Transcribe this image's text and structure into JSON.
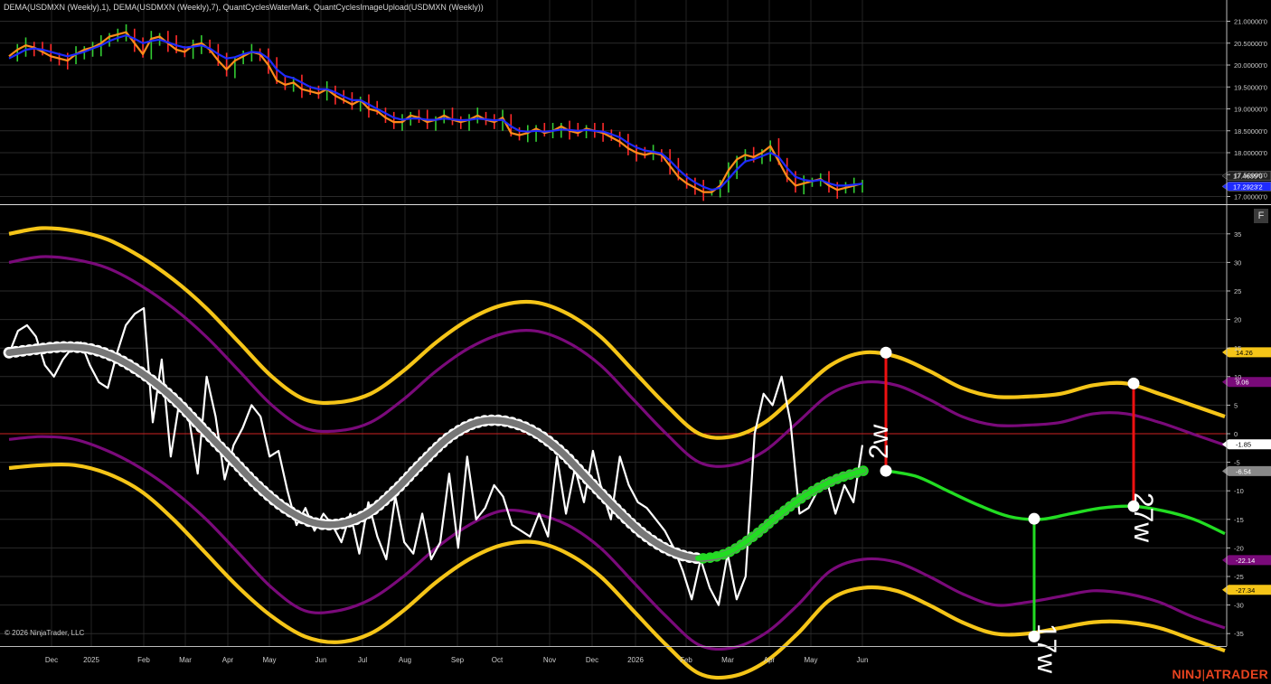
{
  "header": {
    "indicators": "DEMA(USDMXN (Weekly),1), DEMA(USDMXN (Weekly),7), QuantCyclesWaterMark, QuantCyclesImageUpload(USDMXN (Weekly))"
  },
  "footer": {
    "copyright": "© 2026 NinjaTrader, LLC",
    "brand": "NINJATRADER"
  },
  "toolbar": {
    "f_label": "F"
  },
  "colors": {
    "background": "#000000",
    "grid": "#2a2a2a",
    "axis_text": "#cccccc",
    "ma_fast": "#ff8c1a",
    "ma_slow": "#1f2bff",
    "candle_up": "#33cc33",
    "candle_down": "#ff2a2a",
    "outer_band": "#f5c518",
    "inner_band": "#7a0a7a",
    "cycle": "#777777",
    "cycle_dots": "#ffffff",
    "cycle_active": "#22dd22",
    "oscillator": "#ffffff",
    "zero_line": "#cc2222",
    "projection": "#22dd22",
    "marker_red": "#ee1111",
    "marker_green": "#22dd22",
    "brand": "#e8431f"
  },
  "chart_data": [
    {
      "type": "line",
      "name": "price-panel",
      "title": "USDMXN (Weekly)",
      "y_ticks": [
        "21.00000'0",
        "20.50000'0",
        "20.00000'0",
        "19.50000'0",
        "19.00000'0",
        "18.50000'0",
        "18.00000'0",
        "17.50000'0",
        "17.00000'0"
      ],
      "ylim": [
        16.97,
        21.25
      ],
      "series": [
        {
          "name": "DEMA(USDMXN (Weekly),1)",
          "color": "#ff8c1a",
          "values": [
            20.2,
            20.35,
            20.45,
            20.4,
            20.3,
            20.2,
            20.15,
            20.1,
            20.25,
            20.35,
            20.4,
            20.5,
            20.65,
            20.7,
            20.75,
            20.5,
            20.25,
            20.6,
            20.65,
            20.5,
            20.35,
            20.3,
            20.45,
            20.5,
            20.35,
            20.1,
            19.9,
            20.1,
            20.2,
            20.3,
            20.25,
            20.0,
            19.65,
            19.55,
            19.6,
            19.45,
            19.4,
            19.35,
            19.45,
            19.3,
            19.2,
            19.1,
            19.2,
            19.0,
            18.95,
            18.8,
            18.7,
            18.7,
            18.85,
            18.8,
            18.7,
            18.75,
            18.85,
            18.75,
            18.7,
            18.75,
            18.85,
            18.75,
            18.7,
            18.8,
            18.45,
            18.4,
            18.45,
            18.55,
            18.45,
            18.5,
            18.6,
            18.5,
            18.45,
            18.55,
            18.5,
            18.45,
            18.35,
            18.25,
            18.1,
            18.0,
            17.95,
            18.0,
            17.95,
            17.7,
            17.45,
            17.3,
            17.2,
            17.1,
            17.1,
            17.25,
            17.6,
            17.85,
            17.95,
            17.9,
            18.0,
            18.15,
            17.8,
            17.45,
            17.25,
            17.3,
            17.35,
            17.4,
            17.25,
            17.15,
            17.2,
            17.25,
            17.3
          ]
        },
        {
          "name": "DEMA(USDMXN (Weekly),7)",
          "color": "#1f2bff",
          "values": [
            20.15,
            20.25,
            20.35,
            20.38,
            20.35,
            20.3,
            20.25,
            20.2,
            20.25,
            20.3,
            20.38,
            20.45,
            20.55,
            20.62,
            20.68,
            20.6,
            20.5,
            20.55,
            20.58,
            20.52,
            20.45,
            20.4,
            20.42,
            20.45,
            20.38,
            20.25,
            20.15,
            20.18,
            20.25,
            20.3,
            20.28,
            20.15,
            19.9,
            19.75,
            19.7,
            19.6,
            19.5,
            19.45,
            19.45,
            19.38,
            19.28,
            19.2,
            19.2,
            19.1,
            19.0,
            18.9,
            18.8,
            18.75,
            18.78,
            18.78,
            18.75,
            18.75,
            18.78,
            18.76,
            18.74,
            18.75,
            18.78,
            18.76,
            18.74,
            18.75,
            18.6,
            18.5,
            18.48,
            18.5,
            18.48,
            18.5,
            18.53,
            18.52,
            18.5,
            18.52,
            18.5,
            18.48,
            18.42,
            18.35,
            18.22,
            18.12,
            18.05,
            18.02,
            17.98,
            17.82,
            17.62,
            17.45,
            17.32,
            17.22,
            17.15,
            17.2,
            17.4,
            17.62,
            17.8,
            17.85,
            17.92,
            18.0,
            17.9,
            17.65,
            17.45,
            17.38,
            17.35,
            17.38,
            17.3,
            17.25,
            17.25,
            17.27,
            17.29
          ]
        }
      ],
      "price_labels": [
        "17.4639'0",
        "17.2923'2"
      ]
    },
    {
      "type": "line",
      "name": "cycle-panel",
      "y_ticks": [
        35,
        30,
        25,
        20,
        15,
        10,
        5,
        0,
        -5,
        -10,
        -15,
        -20,
        -25,
        -30,
        -35
      ],
      "ylim": [
        -36.7,
        39.3
      ],
      "x_ticks": [
        "Dec",
        "2025",
        "Feb",
        "Mar",
        "Apr",
        "May",
        "Jun",
        "Jul",
        "Aug",
        "Sep",
        "Oct",
        "Nov",
        "Dec",
        "2026",
        "Feb",
        "Mar",
        "Apr",
        "May",
        "Jun"
      ],
      "value_labels": [
        {
          "text": "14.26",
          "value": 14.26,
          "color": "#f5c518"
        },
        {
          "text": "9.06",
          "value": 9.06,
          "color": "#7a0a7a"
        },
        {
          "text": "-1.85",
          "value": -1.85,
          "color": "#ffffff"
        },
        {
          "text": "-6.54",
          "value": -6.54,
          "color": "#888888"
        },
        {
          "text": "-22.14",
          "value": -22.14,
          "color": "#7a0a7a"
        },
        {
          "text": "-27.34",
          "value": -27.34,
          "color": "#f5c518"
        }
      ],
      "annotations": [
        {
          "text": "2w",
          "color": "#ee1111",
          "y_top": 14.2,
          "y_bottom": -6.5
        },
        {
          "text": "27w",
          "color": "#ee1111",
          "y_top": 8.8,
          "y_bottom": -12.7
        },
        {
          "text": "17w",
          "color": "#22dd22",
          "y_top": -14.9,
          "y_bottom": -35.5
        }
      ],
      "series": [
        {
          "name": "outer-upper",
          "color": "#f5c518",
          "values": [
            35,
            36,
            35.5,
            34,
            31,
            27,
            22,
            16,
            10,
            6,
            5.5,
            7,
            11,
            16,
            20,
            22.5,
            23,
            21,
            17,
            11,
            5,
            0,
            -0.5,
            2,
            7,
            12,
            14.2,
            13.5,
            11,
            8,
            6.5,
            6.5,
            7,
            8.5,
            8.8,
            7,
            5,
            3
          ]
        },
        {
          "name": "inner-upper",
          "color": "#7a0a7a",
          "values": [
            30,
            31,
            30.5,
            29,
            26,
            22,
            17,
            11,
            5,
            1,
            0.5,
            2,
            6,
            11,
            15,
            17.5,
            18,
            16,
            12,
            6,
            0,
            -5,
            -5.5,
            -3,
            2,
            7,
            9,
            8.5,
            6,
            3,
            1.5,
            1.5,
            2,
            3.5,
            3.5,
            2,
            0,
            -2
          ]
        },
        {
          "name": "inner-lower",
          "color": "#7a0a7a",
          "values": [
            -1,
            -0.5,
            -1,
            -3,
            -6,
            -10,
            -15,
            -21,
            -27,
            -31,
            -31,
            -29,
            -25,
            -20,
            -16,
            -13.5,
            -14,
            -16,
            -20,
            -26,
            -32,
            -37,
            -37.5,
            -35,
            -30,
            -24,
            -22,
            -22.5,
            -25,
            -28,
            -30,
            -29.5,
            -28.5,
            -27.5,
            -28,
            -29.5,
            -32,
            -34
          ]
        },
        {
          "name": "outer-lower",
          "color": "#f5c518",
          "values": [
            -6,
            -5.5,
            -5.5,
            -7,
            -10,
            -15,
            -21,
            -27,
            -32,
            -35.5,
            -36.5,
            -35,
            -31,
            -26,
            -22,
            -19.5,
            -19,
            -21,
            -25,
            -31,
            -37,
            -42,
            -42.5,
            -40,
            -35,
            -29,
            -27,
            -27.5,
            -30,
            -33,
            -35,
            -35,
            -34,
            -33,
            -33,
            -34,
            -36,
            -38
          ]
        },
        {
          "name": "cycle",
          "color": "#777777",
          "values": [
            14.2,
            14.8,
            15.2,
            14.8,
            13,
            10,
            6,
            1,
            -4,
            -9,
            -13,
            -15.5,
            -15.8,
            -14,
            -10,
            -5,
            -0.5,
            2,
            2.2,
            0.5,
            -3,
            -8,
            -13,
            -17.5,
            -20.5,
            -21.8,
            -21,
            -18,
            -14,
            -10.5,
            -8,
            -6.5
          ]
        },
        {
          "name": "projection",
          "color": "#22dd22",
          "values": [
            -6.5,
            -7.5,
            -10,
            -12.5,
            -14.5,
            -15,
            -14,
            -13,
            -12.7,
            -13.5,
            -15,
            -17.5
          ]
        },
        {
          "name": "oscillator",
          "color": "#ffffff",
          "values": [
            14,
            18,
            19,
            17,
            12,
            10,
            13,
            15,
            16,
            12,
            9,
            8,
            14,
            19,
            21,
            22,
            2,
            13,
            -4,
            6,
            3,
            -7,
            10,
            3,
            -8,
            -2,
            1,
            5,
            3,
            -4,
            -3,
            -10,
            -16,
            -13,
            -17,
            -14,
            -16,
            -19,
            -14,
            -21,
            -12,
            -18,
            -22,
            -11,
            -19,
            -21,
            -14,
            -22,
            -19,
            -7,
            -20,
            -4,
            -15,
            -13,
            -9,
            -11,
            -16,
            -17,
            -18,
            -14,
            -18,
            -4,
            -14,
            -6,
            -12,
            -3,
            -10,
            -15,
            -4,
            -9,
            -12,
            -13,
            -15,
            -17,
            -20,
            -24,
            -29,
            -22,
            -27,
            -30,
            -21,
            -29,
            -25,
            0,
            7,
            5,
            10,
            2,
            -14,
            -13,
            -10,
            -8,
            -14,
            -9,
            -12,
            -2
          ]
        }
      ]
    }
  ]
}
